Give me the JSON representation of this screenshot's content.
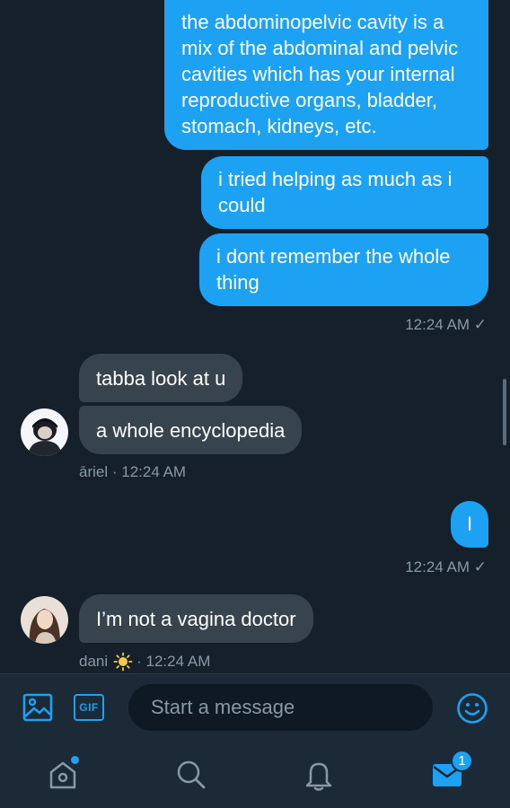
{
  "messages": [
    {
      "direction": "outgoing",
      "text": "the abdominopelvic cavity is a mix of the abdominal and pelvic cavities which has your internal reproductive organs, bladder, stomach, kidneys, etc."
    },
    {
      "direction": "outgoing",
      "text": "i tried helping as much as i could"
    },
    {
      "direction": "outgoing",
      "text": "i dont remember the whole thing"
    },
    {
      "direction": "incoming",
      "text": "tabba look at u"
    },
    {
      "direction": "incoming",
      "text": "a whole encyclopedia"
    },
    {
      "direction": "outgoing",
      "text": "I"
    },
    {
      "direction": "incoming",
      "text": "I’m not a vagina doctor"
    }
  ],
  "meta": {
    "outgoing_1": "12:24 AM ✓",
    "incoming_1_sender": "āriel",
    "incoming_1_time": "· 12:24 AM",
    "outgoing_2": "12:24 AM ✓",
    "incoming_2_sender": "dani",
    "incoming_2_emoji": "sun",
    "incoming_2_time": "· 12:24 AM"
  },
  "composer": {
    "placeholder": "Start a message",
    "gif_label": "GIF"
  },
  "tabbar": {
    "messages_badge": "1",
    "icons": [
      "home-icon",
      "search-icon",
      "notifications-icon",
      "messages-icon"
    ]
  },
  "colors": {
    "background": "#15202b",
    "outgoing_bubble": "#1da1f2",
    "incoming_bubble": "#38444d",
    "muted_text": "#8899a6",
    "accent": "#1da1f2"
  }
}
